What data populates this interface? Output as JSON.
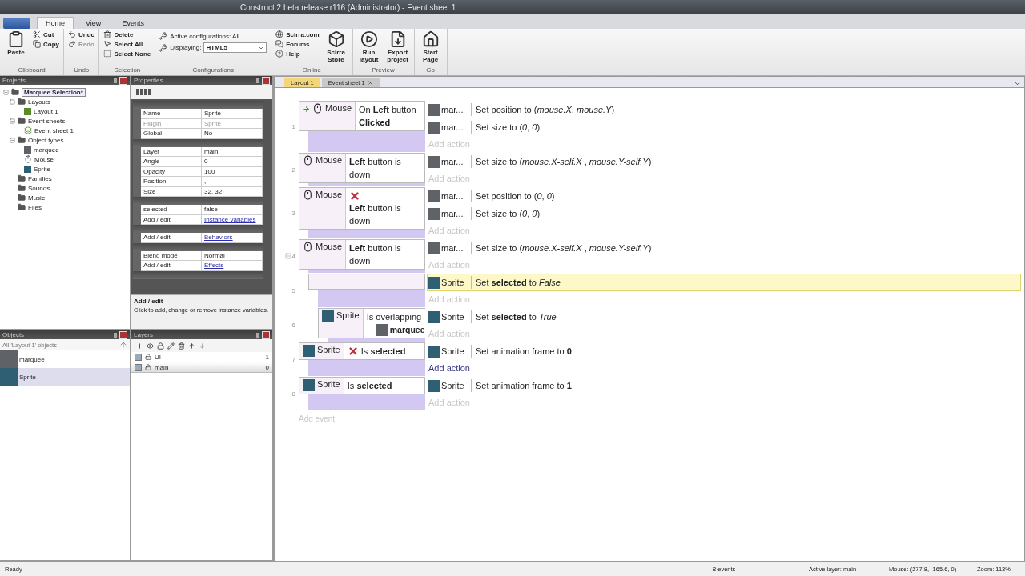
{
  "window": {
    "title": "Construct 2 beta release r116 (Administrator) - Event sheet 1"
  },
  "ribbon_tabs": [
    {
      "label": "Home",
      "selected": true
    },
    {
      "label": "View",
      "selected": false
    },
    {
      "label": "Events",
      "selected": false
    }
  ],
  "ribbon_groups": [
    {
      "label": "Clipboard",
      "items": [
        {
          "kind": "big",
          "label": "Paste"
        },
        {
          "kind": "stack",
          "entries": [
            {
              "label": "Cut",
              "disabled": false
            },
            {
              "label": "Copy",
              "disabled": false
            }
          ]
        }
      ]
    },
    {
      "label": "Undo",
      "items": [
        {
          "kind": "stack",
          "entries": [
            {
              "label": "Undo",
              "disabled": false
            },
            {
              "label": "Redo",
              "disabled": true
            }
          ]
        }
      ]
    },
    {
      "label": "Selection",
      "items": [
        {
          "kind": "stack",
          "entries": [
            {
              "label": "Delete",
              "disabled": false
            },
            {
              "label": "Select All",
              "disabled": false
            },
            {
              "label": "Select None",
              "disabled": false
            }
          ]
        }
      ]
    },
    {
      "label": "Configurations",
      "items": [
        {
          "kind": "config",
          "active_label": "Active configurations: All",
          "displaying_label": "Displaying:",
          "displaying_value": "HTML5"
        }
      ]
    },
    {
      "label": "Online",
      "items": [
        {
          "kind": "stack",
          "entries": [
            {
              "label": "Scirra.com",
              "disabled": false
            },
            {
              "label": "Forums",
              "disabled": false
            },
            {
              "label": "Help",
              "disabled": false
            }
          ]
        },
        {
          "kind": "big",
          "label": "Scirra Store"
        }
      ]
    },
    {
      "label": "Preview",
      "items": [
        {
          "kind": "big",
          "label": "Run layout"
        },
        {
          "kind": "big",
          "label": "Export project"
        }
      ]
    },
    {
      "label": "Go",
      "items": [
        {
          "kind": "big",
          "label": "Start Page"
        }
      ]
    }
  ],
  "projects_panel": {
    "title": "Projects",
    "tree": [
      {
        "label": "Marquee Selection*",
        "kind": "folder",
        "selected": true,
        "expanded": true,
        "children": [
          {
            "label": "Layouts",
            "kind": "folder",
            "selected": false,
            "expanded": true,
            "children": [
              {
                "label": "Layout 1",
                "kind": "layout",
                "selected": false
              }
            ]
          },
          {
            "label": "Event sheets",
            "kind": "folder",
            "selected": false,
            "expanded": true,
            "children": [
              {
                "label": "Event sheet 1",
                "kind": "sheet",
                "selected": false
              }
            ]
          },
          {
            "label": "Object types",
            "kind": "folder",
            "selected": false,
            "expanded": true,
            "children": [
              {
                "label": "marquee",
                "kind": "object",
                "color": "#5f6368",
                "selected": false
              },
              {
                "label": "Mouse",
                "kind": "mouse",
                "selected": false
              },
              {
                "label": "Sprite",
                "kind": "object",
                "color": "#2f5f73",
                "selected": false
              }
            ]
          },
          {
            "label": "Families",
            "kind": "folder",
            "selected": false
          },
          {
            "label": "Sounds",
            "kind": "folder",
            "selected": false
          },
          {
            "label": "Music",
            "kind": "folder",
            "selected": false
          },
          {
            "label": "Files",
            "kind": "folder",
            "selected": false
          }
        ]
      }
    ]
  },
  "properties_panel": {
    "title": "Properties",
    "rows": [
      {
        "kind": "header"
      },
      {
        "kind": "row",
        "name": "Name",
        "value": "Sprite",
        "disabled": false,
        "link": false
      },
      {
        "kind": "row",
        "name": "Plugin",
        "value": "Sprite",
        "disabled": true,
        "link": false
      },
      {
        "kind": "row",
        "name": "Global",
        "value": "No",
        "disabled": false,
        "link": false
      },
      {
        "kind": "header"
      },
      {
        "kind": "row",
        "name": "Layer",
        "value": "main",
        "disabled": false,
        "link": false
      },
      {
        "kind": "row",
        "name": "Angle",
        "value": "0",
        "disabled": false,
        "link": false
      },
      {
        "kind": "row",
        "name": "Opacity",
        "value": "100",
        "disabled": false,
        "link": false
      },
      {
        "kind": "row",
        "name": "Position",
        "value": ",",
        "disabled": false,
        "link": false
      },
      {
        "kind": "row",
        "name": "Size",
        "value": "32, 32",
        "disabled": false,
        "link": false
      },
      {
        "kind": "header"
      },
      {
        "kind": "row",
        "name": "selected",
        "value": "false",
        "disabled": false,
        "link": false
      },
      {
        "kind": "row",
        "name": "Add / edit",
        "value": "Instance variables",
        "disabled": false,
        "link": true
      },
      {
        "kind": "header"
      },
      {
        "kind": "row",
        "name": "Add / edit",
        "value": "Behaviors",
        "disabled": false,
        "link": true
      },
      {
        "kind": "header"
      },
      {
        "kind": "row",
        "name": "Blend mode",
        "value": "Normal",
        "disabled": false,
        "link": false
      },
      {
        "kind": "row",
        "name": "Add / edit",
        "value": "Effects",
        "disabled": false,
        "link": true
      },
      {
        "kind": "header"
      }
    ],
    "help_title": "Add / edit",
    "help_text": "Click to add, change or remove instance variables."
  },
  "objects_panel": {
    "title": "Objects",
    "filter": "All 'Layout 1' objects",
    "items": [
      {
        "label": "marquee",
        "color": "#5f6368",
        "selected": false
      },
      {
        "label": "Sprite",
        "color": "#2f5f73",
        "selected": true
      }
    ]
  },
  "layers_panel": {
    "title": "Layers",
    "layers": [
      {
        "name": "UI",
        "index": "1",
        "visible": true,
        "locked": false,
        "selected": false
      },
      {
        "name": "main",
        "index": "0",
        "visible": true,
        "locked": false,
        "selected": true
      }
    ]
  },
  "editor_tabs": [
    {
      "label": "Layout 1",
      "selected": true,
      "closable": false
    },
    {
      "label": "Event sheet 1",
      "selected": false,
      "closable": true
    }
  ],
  "events": [
    {
      "number": "1",
      "trigger": true,
      "conditions": [
        {
          "object": "Mouse",
          "kind": "mouse",
          "text": "On **Left** button **Clicked**",
          "inverted": false
        }
      ],
      "actions": [
        {
          "object": "mar...",
          "color": "#5f6368",
          "text": "Set position to (*mouse.X*, *mouse.Y*)",
          "selected": false
        },
        {
          "object": "mar...",
          "color": "#5f6368",
          "text": "Set size to (*0*, *0*)",
          "selected": false
        }
      ],
      "add_action": "Add action",
      "add_action_hovered": false
    },
    {
      "number": "2",
      "trigger": false,
      "conditions": [
        {
          "object": "Mouse",
          "kind": "mouse",
          "text": "**Left** button is down",
          "inverted": false
        }
      ],
      "actions": [
        {
          "object": "mar...",
          "color": "#5f6368",
          "text": "Set size to (*mouse.X-self.X* , *mouse.Y-self.Y*)",
          "selected": false
        }
      ],
      "add_action": "Add action",
      "add_action_hovered": false
    },
    {
      "number": "3",
      "trigger": false,
      "conditions": [
        {
          "object": "Mouse",
          "kind": "mouse",
          "text": "**Left** button is down",
          "inverted": true
        }
      ],
      "actions": [
        {
          "object": "mar...",
          "color": "#5f6368",
          "text": "Set position to (*0*, *0*)",
          "selected": false
        },
        {
          "object": "mar...",
          "color": "#5f6368",
          "text": "Set size to (*0*, *0*)",
          "selected": false
        }
      ],
      "add_action": "Add action",
      "add_action_hovered": false
    },
    {
      "number": "4",
      "trigger": false,
      "expanded": true,
      "conditions": [
        {
          "object": "Mouse",
          "kind": "mouse",
          "text": "**Left** button is down",
          "inverted": false
        }
      ],
      "actions": [
        {
          "object": "mar...",
          "color": "#5f6368",
          "text": "Set size to (*mouse.X-self.X* , *mouse.Y-self.Y*)",
          "selected": false
        }
      ],
      "add_action": "Add action",
      "add_action_hovered": false,
      "children": [
        {
          "number": "5",
          "trigger": false,
          "actions": [
            {
              "object": "Sprite",
              "color": "#2f5f73",
              "text": "Set **selected** to *False*",
              "selected": true
            }
          ],
          "add_action": "Add action",
          "add_action_hovered": false,
          "children": [
            {
              "number": "6",
              "trigger": false,
              "conditions": [
                {
                  "object": "Sprite",
                  "kind": "object",
                  "color": "#2f5f73",
                  "text": "Is overlapping",
                  "param": {
                    "object": "marquee",
                    "color": "#5f6368"
                  },
                  "inverted": false
                }
              ],
              "actions": [
                {
                  "object": "Sprite",
                  "color": "#2f5f73",
                  "text": "Set **selected** to *True*",
                  "selected": false
                }
              ],
              "add_action": "Add action",
              "add_action_hovered": false
            }
          ]
        }
      ]
    },
    {
      "number": "7",
      "trigger": false,
      "conditions": [
        {
          "object": "Sprite",
          "kind": "object",
          "color": "#2f5f73",
          "text": "Is **selected**",
          "inverted": true
        }
      ],
      "actions": [
        {
          "object": "Sprite",
          "color": "#2f5f73",
          "text": "Set animation frame to **0**",
          "selected": false
        }
      ],
      "add_action": "Add action",
      "add_action_hovered": true
    },
    {
      "number": "8",
      "trigger": false,
      "conditions": [
        {
          "object": "Sprite",
          "kind": "object",
          "color": "#2f5f73",
          "text": "Is **selected**",
          "inverted": false
        }
      ],
      "actions": [
        {
          "object": "Sprite",
          "color": "#2f5f73",
          "text": "Set animation frame to **1**",
          "selected": false
        }
      ],
      "add_action": "Add action",
      "add_action_hovered": false
    }
  ],
  "add_event": "Add event",
  "status_bar": {
    "left": "Ready",
    "events": "8 events",
    "layer": "Active layer: main",
    "mouse": "Mouse: (277.8, -165.6, 0)",
    "zoom": "Zoom: 113%"
  }
}
